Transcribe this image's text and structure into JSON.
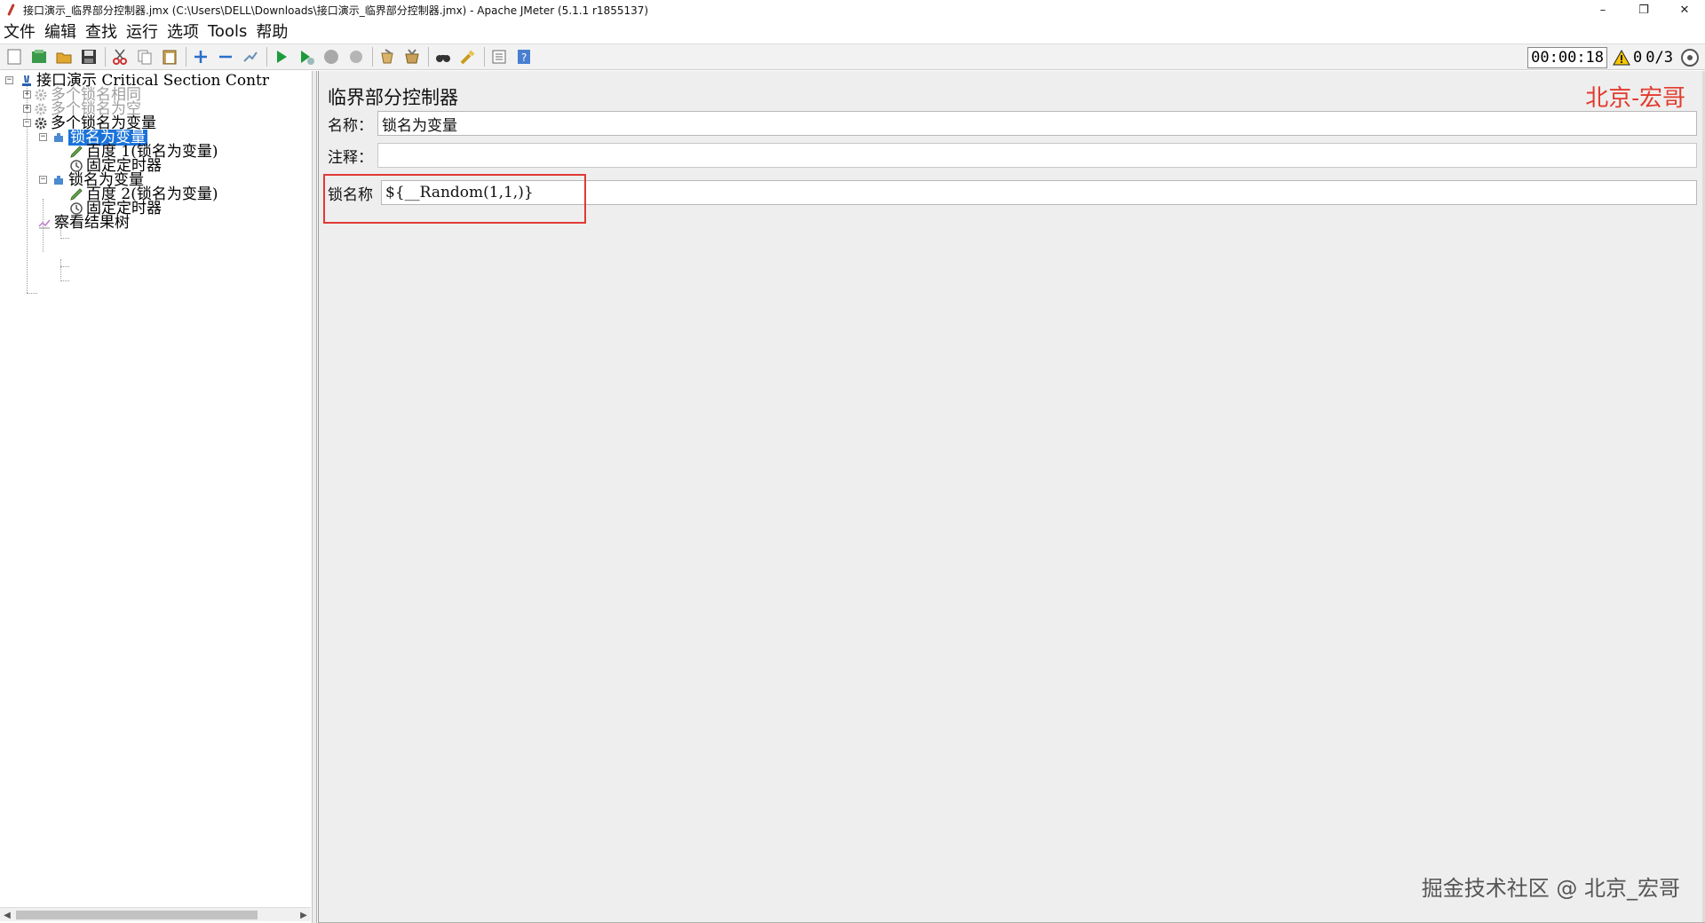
{
  "window": {
    "title": "接口演示_临界部分控制器.jmx (C:\\Users\\DELL\\Downloads\\接口演示_临界部分控制器.jmx) - Apache JMeter (5.1.1 r1855137)",
    "minimize": "–",
    "restore": "❐",
    "close": "✕"
  },
  "menu": {
    "items": [
      "文件",
      "编辑",
      "查找",
      "运行",
      "选项",
      "Tools",
      "帮助"
    ]
  },
  "toolbar": {
    "timer": "00:00:18",
    "warning_count": "0",
    "threads": "0/3"
  },
  "tree": {
    "nodes": [
      {
        "label": "接口演示 Critical Section Contr",
        "state": "normal"
      },
      {
        "label": "多个锁名相同",
        "state": "disabled"
      },
      {
        "label": "多个锁名为空",
        "state": "disabled"
      },
      {
        "label": "多个锁名为变量",
        "state": "normal"
      },
      {
        "label": "锁名为变量",
        "state": "selected"
      },
      {
        "label": "百度 1(锁名为变量)",
        "state": "normal"
      },
      {
        "label": "固定定时器",
        "state": "normal"
      },
      {
        "label": "锁名为变量",
        "state": "normal"
      },
      {
        "label": "百度 2(锁名为变量)",
        "state": "normal"
      },
      {
        "label": "固定定时器",
        "state": "normal"
      },
      {
        "label": "察看结果树",
        "state": "normal"
      }
    ]
  },
  "editor": {
    "panel_title": "临界部分控制器",
    "name_label": "名称：",
    "name_value": "锁名为变量",
    "comment_label": "注释：",
    "comment_value": "",
    "lock_label": "锁名称",
    "lock_value": "${__Random(1,1,)}"
  },
  "watermarks": {
    "top": "北京-宏哥",
    "bottom": "掘金技术社区 @ 北京_宏哥"
  },
  "colors": {
    "selection": "#1a73d9",
    "highlight_box": "#e03a35",
    "watermark_top": "#e23b2e"
  }
}
